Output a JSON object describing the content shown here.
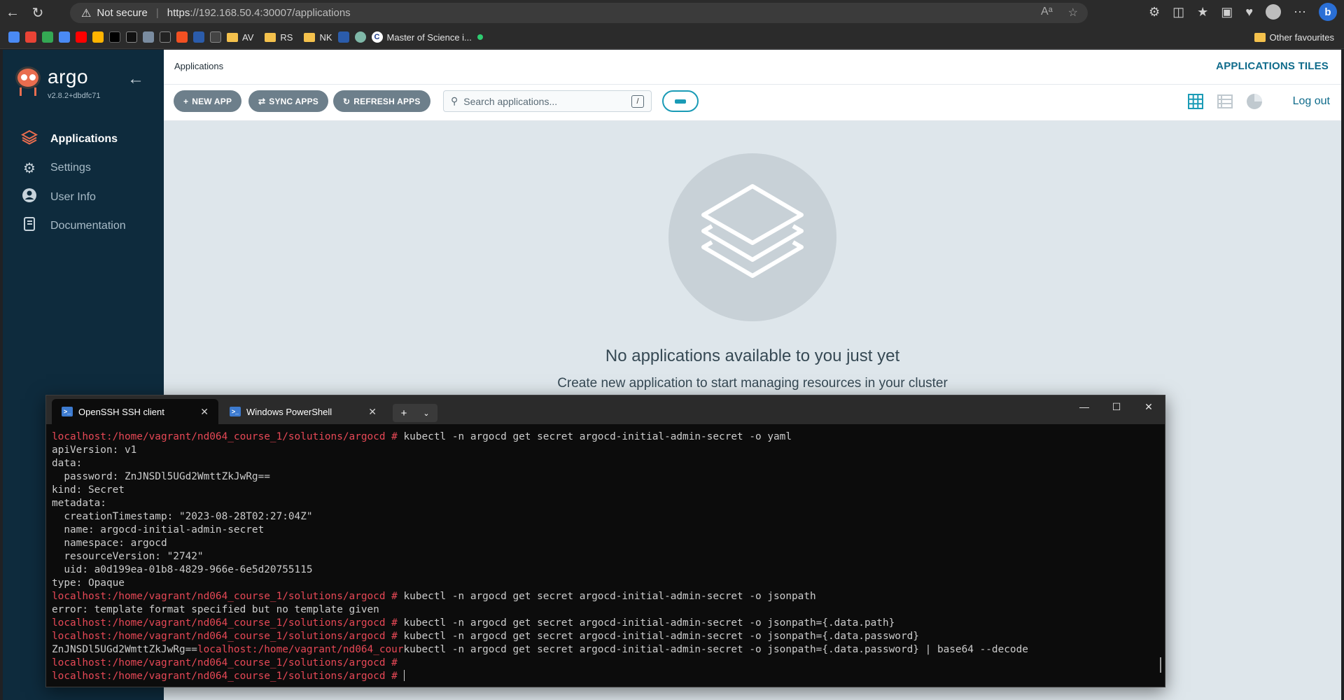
{
  "browser": {
    "security_label": "Not secure",
    "url_scheme": "https",
    "url_rest": "://192.168.50.4:30007/applications",
    "bookmarks": [
      {
        "label": "",
        "color": "#4a8af4"
      },
      {
        "label": "",
        "color": "#ea4335"
      },
      {
        "label": "",
        "color": "#34a853"
      },
      {
        "label": "",
        "color": "#4a8af4"
      },
      {
        "label": "",
        "color": "#ff0000"
      },
      {
        "label": "",
        "color": "#ffb400"
      },
      {
        "label": "",
        "color": "#000000"
      },
      {
        "label": "",
        "color": "#111111"
      },
      {
        "label": "",
        "color": "#7a8ca0"
      },
      {
        "label": "",
        "color": "#222222"
      },
      {
        "label": "",
        "color": "#f25022"
      },
      {
        "label": "",
        "color": "#2b5cab"
      },
      {
        "label": "",
        "color": "#444444"
      }
    ],
    "bookmark_folders": [
      "AV",
      "RS",
      "NK"
    ],
    "bookmark_link": "Master of Science i...",
    "other_favourites": "Other favourites"
  },
  "sidebar": {
    "brand": "argo",
    "version": "v2.8.2+dbdfc71",
    "items": [
      {
        "label": "Applications",
        "icon": "layers-icon",
        "active": true
      },
      {
        "label": "Settings",
        "icon": "gears-icon",
        "active": false
      },
      {
        "label": "User Info",
        "icon": "user-icon",
        "active": false
      },
      {
        "label": "Documentation",
        "icon": "book-icon",
        "active": false
      }
    ]
  },
  "header": {
    "breadcrumb": "Applications",
    "title": "APPLICATIONS TILES",
    "logout": "Log out"
  },
  "toolbar": {
    "new_app": "NEW APP",
    "sync_apps": "SYNC APPS",
    "refresh_apps": "REFRESH APPS",
    "search_placeholder": "Search applications...",
    "search_shortcut": "/"
  },
  "empty_state": {
    "title": "No applications available to you just yet",
    "subtitle": "Create new application to start managing resources in your cluster"
  },
  "terminal": {
    "tabs": [
      {
        "label": "OpenSSH SSH client",
        "active": true
      },
      {
        "label": "Windows PowerShell",
        "active": false
      }
    ],
    "prompt": "localhost:/home/vagrant/nd064_course_1/solutions/argocd # ",
    "lines": [
      {
        "prompt": true,
        "text": "kubectl -n argocd get secret argocd-initial-admin-secret -o yaml"
      },
      {
        "prompt": false,
        "text": "apiVersion: v1"
      },
      {
        "prompt": false,
        "text": "data:"
      },
      {
        "prompt": false,
        "text": "  password: ZnJNSDl5UGd2WmttZkJwRg=="
      },
      {
        "prompt": false,
        "text": "kind: Secret"
      },
      {
        "prompt": false,
        "text": "metadata:"
      },
      {
        "prompt": false,
        "text": "  creationTimestamp: \"2023-08-28T02:27:04Z\""
      },
      {
        "prompt": false,
        "text": "  name: argocd-initial-admin-secret"
      },
      {
        "prompt": false,
        "text": "  namespace: argocd"
      },
      {
        "prompt": false,
        "text": "  resourceVersion: \"2742\""
      },
      {
        "prompt": false,
        "text": "  uid: a0d199ea-01b8-4829-966e-6e5d20755115"
      },
      {
        "prompt": false,
        "text": "type: Opaque"
      },
      {
        "prompt": true,
        "text": "kubectl -n argocd get secret argocd-initial-admin-secret -o jsonpath"
      },
      {
        "prompt": false,
        "text": "error: template format specified but no template given"
      },
      {
        "prompt": true,
        "text": "kubectl -n argocd get secret argocd-initial-admin-secret -o jsonpath={.data.path}"
      },
      {
        "prompt": true,
        "text": "kubectl -n argocd get secret argocd-initial-admin-secret -o jsonpath={.data.password}"
      },
      {
        "prompt": false,
        "mixed": true,
        "pre": "ZnJNSDl5UGd2WmttZkJwRg==",
        "mid": "localhost:/home/vagrant/nd064_cour",
        "text": "kubectl -n argocd get secret argocd-initial-admin-secret -o jsonpath={.data.password} | base64 --decode"
      },
      {
        "prompt": true,
        "text": ""
      },
      {
        "prompt": true,
        "text": "",
        "cursor": true
      }
    ]
  }
}
